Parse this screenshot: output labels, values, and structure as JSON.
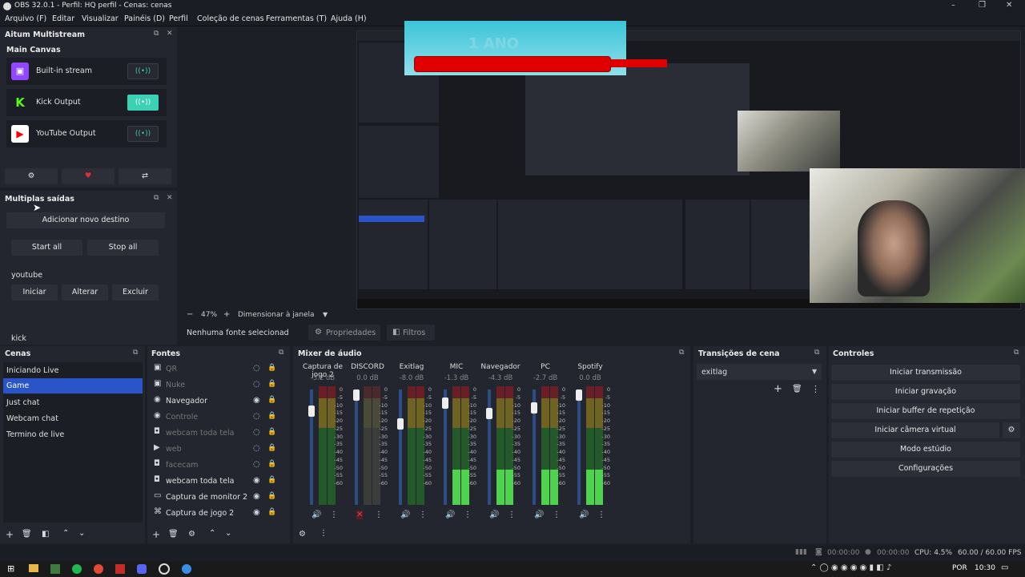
{
  "window": {
    "title": "OBS 32.0.1 - Perfil: HQ perfil - Cenas: cenas",
    "controls": [
      "–",
      "❐",
      "✕"
    ]
  },
  "menu": [
    "Arquivo (F)",
    "Editar",
    "Visualizar",
    "Painéis (D)",
    "Perfil",
    "Coleção de cenas",
    "Ferramentas (T)",
    "Ajuda (H)"
  ],
  "multistream": {
    "title": "Aitum Multistream",
    "canvas_title": "Main Canvas",
    "outputs": [
      {
        "label": "Built-in stream",
        "color": "#9146ff",
        "glyph": "▣",
        "active": false
      },
      {
        "label": "Kick Output",
        "color": "#53fc18",
        "glyph": "K",
        "active": true
      },
      {
        "label": "YouTube Output",
        "color": "#ff0000",
        "glyph": "▶",
        "active": false
      }
    ],
    "toolbar_icons": [
      "gear-icon",
      "heart-icon",
      "switch-icon"
    ]
  },
  "multiple_outputs": {
    "title": "Multiplas saídas",
    "add_label": "Adicionar novo destino",
    "start_all": "Start all",
    "stop_all": "Stop all",
    "destinations": [
      {
        "name": "youtube",
        "buttons": [
          "Iniciar",
          "Alterar",
          "Excluir"
        ]
      },
      {
        "name": "kick"
      }
    ]
  },
  "preview": {
    "zoom": "47%",
    "mode": "Dimensionar à janela",
    "overlay_text": "1 ANO"
  },
  "status_strip": {
    "no_source": "Nenhuma fonte selecionad",
    "properties": "Propriedades",
    "filters": "Filtros"
  },
  "scenes": {
    "title": "Cenas",
    "items": [
      "Iniciando Live",
      "Game",
      "Just chat",
      "Webcam chat",
      "Termino de live"
    ],
    "selected": "Game"
  },
  "sources": {
    "title": "Fontes",
    "items": [
      {
        "label": "QR",
        "icon": "image-icon",
        "visible": false
      },
      {
        "label": "Nuke",
        "icon": "image-icon",
        "visible": false
      },
      {
        "label": "Navegador",
        "icon": "browser-icon",
        "visible": true
      },
      {
        "label": "Controle",
        "icon": "browser-icon",
        "visible": false
      },
      {
        "label": "webcam toda tela",
        "icon": "camera-icon",
        "visible": false
      },
      {
        "label": "web",
        "icon": "play-icon",
        "visible": false
      },
      {
        "label": "facecam",
        "icon": "camera-icon",
        "visible": false
      },
      {
        "label": "webcam toda tela",
        "icon": "camera-icon",
        "visible": true
      },
      {
        "label": "Captura de monitor 2",
        "icon": "monitor-icon",
        "visible": true
      },
      {
        "label": "Captura de jogo 2",
        "icon": "gamepad-icon",
        "visible": true
      }
    ]
  },
  "mixer": {
    "title": "Mixer de áudio",
    "scale": [
      "0",
      "-5",
      "-10",
      "-15",
      "-20",
      "-25",
      "-30",
      "-35",
      "-40",
      "-45",
      "-50",
      "-55",
      "-60"
    ],
    "channels": [
      {
        "name": "Captura de jogo 2",
        "db": "-3.2 dB",
        "level": 0.85,
        "muted": false
      },
      {
        "name": "DISCORD",
        "db": "0.0 dB",
        "level": 1.0,
        "muted": true
      },
      {
        "name": "Exitlag",
        "db": "-8.0 dB",
        "level": 0.72,
        "muted": false
      },
      {
        "name": "MIC",
        "db": "-1.3 dB",
        "level": 0.92,
        "muted": false
      },
      {
        "name": "Navegador",
        "db": "-4.3 dB",
        "level": 0.82,
        "muted": false
      },
      {
        "name": "PC",
        "db": "-2.7 dB",
        "level": 0.88,
        "muted": false
      },
      {
        "name": "Spotify",
        "db": "0.0 dB",
        "level": 1.0,
        "muted": false
      }
    ]
  },
  "transitions": {
    "title": "Transições de cena",
    "selected": "exitlag"
  },
  "controls": {
    "title": "Controles",
    "buttons": [
      "Iniciar transmissão",
      "Iniciar gravação",
      "Iniciar buffer de repetição",
      "Iniciar câmera virtual",
      "Modo estúdio",
      "Configurações"
    ]
  },
  "statusbar": {
    "time1": "00:00:00",
    "time2": "00:00:00",
    "cpu": "CPU: 4.5%",
    "fps": "60.00 / 60.00 FPS"
  },
  "taskbar": {
    "lang": "POR",
    "clock": "10:30"
  }
}
